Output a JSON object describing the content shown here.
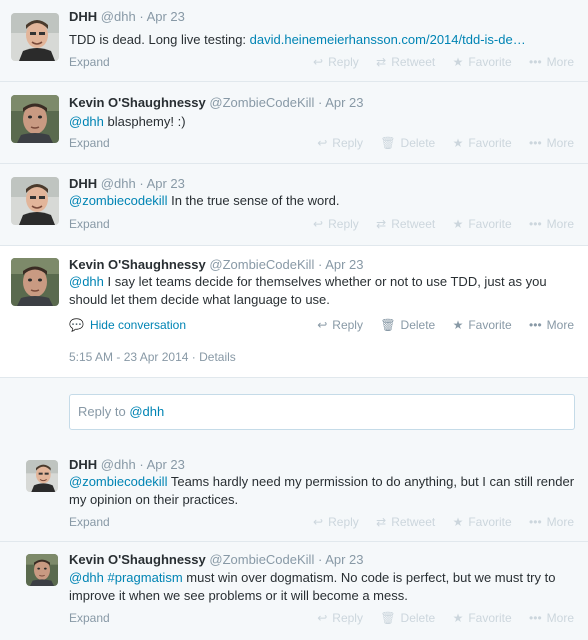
{
  "actions": {
    "reply": "Reply",
    "retweet": "Retweet",
    "delete": "Delete",
    "favorite": "Favorite",
    "more": "More",
    "expand": "Expand"
  },
  "icons": {
    "reply": "reply-arrow-icon",
    "retweet": "retweet-icon",
    "delete": "trash-icon",
    "favorite": "star-icon",
    "more": "more-dots-icon",
    "conversation": "speech-bubble-icon"
  },
  "colors": {
    "link": "#0084b4",
    "muted": "#8899a6",
    "disabled": "#ccd6dd",
    "background": "#f5f8fa"
  },
  "tweets": [
    {
      "name": "DHH",
      "handle": "@dhh",
      "time": "Apr 23",
      "text": "TDD is dead. Long live testing: ",
      "link": "david.heinemeierhansson.com/2014/tdd-is-de…"
    },
    {
      "name": "Kevin O'Shaughnessy",
      "handle": "@ZombieCodeKill",
      "time": "Apr 23",
      "mention": "@dhh",
      "text": " blasphemy! :)"
    },
    {
      "name": "DHH",
      "handle": "@dhh",
      "time": "Apr 23",
      "mention": "@zombiecodekill",
      "text": " In the true sense of the word."
    },
    {
      "name": "Kevin O'Shaughnessy",
      "handle": "@ZombieCodeKill",
      "time": "Apr 23",
      "mention": "@dhh",
      "text": " I say let teams decide for themselves whether or not to use TDD, just as you should let them decide what language to use.",
      "hide_conversation": "Hide conversation",
      "timestamp": "5:15 AM - 23 Apr 2014",
      "details": "Details"
    },
    {
      "name": "DHH",
      "handle": "@dhh",
      "time": "Apr 23",
      "mention": "@zombiecodekill",
      "text": " Teams hardly need my permission to do anything, but I can still render my opinion on their practices."
    },
    {
      "name": "Kevin O'Shaughnessy",
      "handle": "@ZombieCodeKill",
      "time": "Apr 23",
      "mention": "@dhh",
      "hashtag": "#pragmatism",
      "text": " must win over dogmatism. No code is perfect, but we must try to improve it when we see problems or it will become a mess."
    }
  ],
  "reply_box": {
    "prefix": "Reply to ",
    "handle": "@dhh"
  }
}
